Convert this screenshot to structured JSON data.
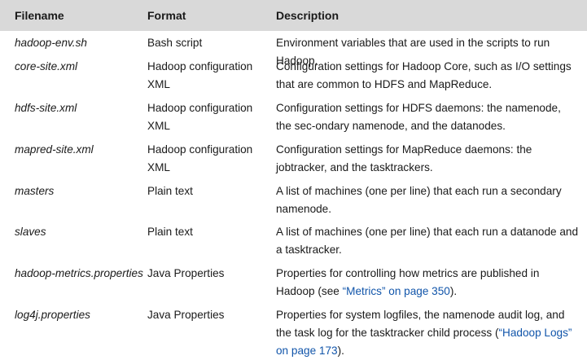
{
  "header": {
    "filename": "Filename",
    "format": "Format",
    "description": "Description"
  },
  "rows": [
    {
      "filename": "hadoop-env.sh",
      "format": "Bash script",
      "description": "Environment variables that are used in the scripts to run Hadoop."
    },
    {
      "filename": "core-site.xml",
      "format": "Hadoop configuration XML",
      "description": "Configuration settings for Hadoop Core, such as I/O settings that are common to HDFS and MapReduce."
    },
    {
      "filename": "hdfs-site.xml",
      "format": "Hadoop configuration XML",
      "description": "Configuration settings for HDFS daemons: the namenode, the sec-ondary namenode, and the datanodes."
    },
    {
      "filename": "mapred-site.xml",
      "format": "Hadoop configuration XML",
      "description": "Configuration settings for MapReduce daemons: the jobtracker, and the tasktrackers."
    },
    {
      "filename": "masters",
      "format": "Plain text",
      "description": "A list of machines (one per line) that each run a secondary namenode."
    },
    {
      "filename": "slaves",
      "format": "Plain text",
      "description": "A list of machines (one per line) that each run a datanode and a tasktracker."
    },
    {
      "filename": "hadoop-metrics.properties",
      "format": "Java Properties",
      "description_before": "Properties for controlling how metrics are published in Hadoop (see ",
      "description_link": "“Metrics” on page 350",
      "description_after": ")."
    },
    {
      "filename": "log4j.properties",
      "format": "Java Properties",
      "description_before": "Properties for system logfiles, the namenode audit log, and the task log for the tasktracker child process (",
      "description_link": "“Hadoop Logs” on page 173",
      "description_after": ")."
    }
  ],
  "colors": {
    "header_bg": "#d9d9d9",
    "link": "#1155aa"
  }
}
